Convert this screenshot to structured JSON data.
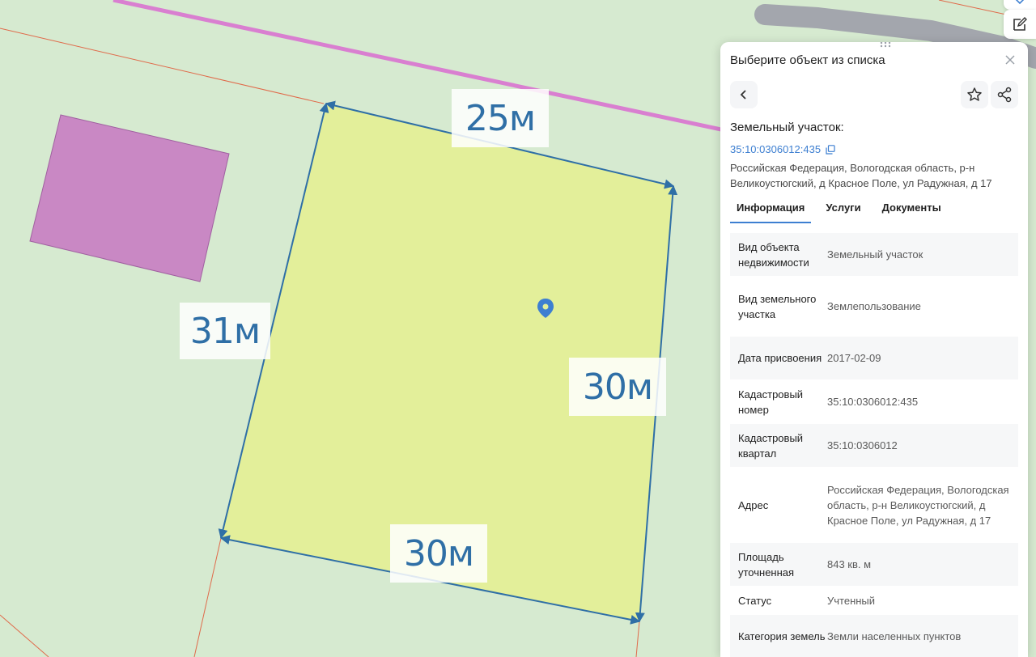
{
  "map": {
    "dimension_labels": [
      "25м",
      "31м",
      "30м",
      "30м"
    ],
    "colors": {
      "background": "#d6ead0",
      "parcel_fill": "#e3ef9a",
      "neighbor_fill": "#c988c4",
      "boundary_red": "#e06a4a",
      "road_pink": "#d97fd0",
      "arrow_blue": "#2f6fa6",
      "marker_blue": "#3d7fd1",
      "road_gray": "#a3a6ad"
    },
    "marker_icon": "map-pin-icon"
  },
  "toolbar": {
    "icons": [
      "chevron-down-icon",
      "edit-icon"
    ]
  },
  "panel": {
    "title": "Выберите объект из списка",
    "close_icon": "close-icon",
    "back_icon": "chevron-left-icon",
    "star_icon": "star-icon",
    "share_icon": "share-icon",
    "drag_icon": "drag-handle-icon",
    "object_kind": "Земельный участок:",
    "cadastral_number": "35:10:0306012:435",
    "copy_icon": "copy-icon",
    "address": "Российская Федерация, Вологодская область, р-н Великоустюгский, д Красное Поле, ул Радужная, д 17",
    "tabs": [
      "Информация",
      "Услуги",
      "Документы"
    ],
    "active_tab": "Информация",
    "rows": [
      {
        "key": "Вид объекта недвижимости",
        "value": "Земельный участок"
      },
      {
        "key": "Вид земельного участка",
        "value": "Землепользование"
      },
      {
        "key": "Дата присвоения",
        "value": "2017-02-09"
      },
      {
        "key": "Кадастровый номер",
        "value": "35:10:0306012:435"
      },
      {
        "key": "Кадастровый квартал",
        "value": "35:10:0306012"
      },
      {
        "key": "Адрес",
        "value": "Российская Федерация, Вологодская область, р-н Великоустюгский, д Красное Поле, ул Радужная, д 17"
      },
      {
        "key": "Площадь уточненная",
        "value": "843 кв. м"
      },
      {
        "key": "Статус",
        "value": "Учтенный"
      },
      {
        "key": "Категория земель",
        "value": "Земли населенных пунктов"
      }
    ]
  }
}
